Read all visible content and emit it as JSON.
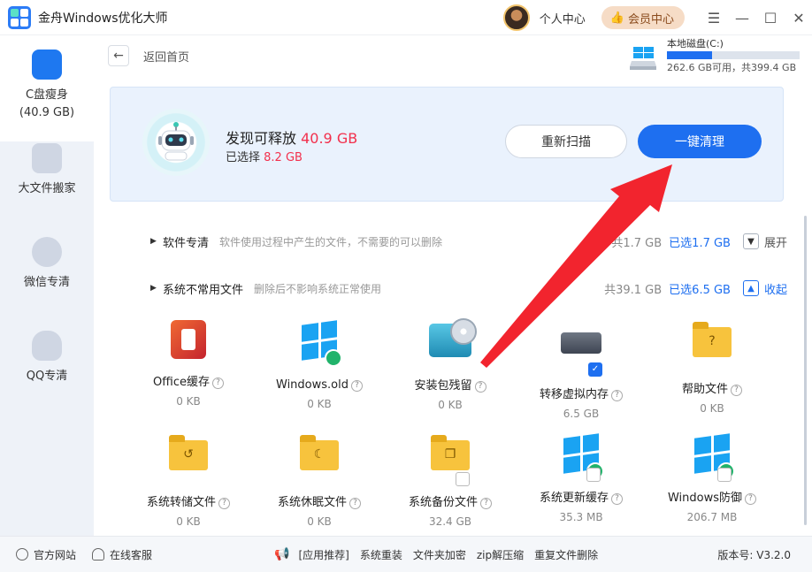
{
  "app": {
    "title": "金舟Windows优化大师",
    "user_center": "个人中心",
    "vip": "会员中心"
  },
  "sidebar": {
    "items": [
      {
        "label": "C盘瘦身",
        "sub": "(40.9 GB)"
      },
      {
        "label": "大文件搬家"
      },
      {
        "label": "微信专清"
      },
      {
        "label": "QQ专清"
      }
    ]
  },
  "nav": {
    "back": "返回首页"
  },
  "disk": {
    "name": "本地磁盘(C:)",
    "info": "262.6 GB可用，共399.4 GB",
    "used_fraction": 0.34
  },
  "scan": {
    "found_label": "发现可释放",
    "found_value": "40.9 GB",
    "selected_label": "已选择",
    "selected_value": "8.2 GB",
    "rescan": "重新扫描",
    "clean": "一键清理"
  },
  "categories": [
    {
      "name": "软件专清",
      "desc": "软件使用过程中产生的文件，不需要的可以删除",
      "total": "共1.7 GB",
      "selected": "已选1.7 GB",
      "toggle": "展开"
    },
    {
      "name": "系统不常用文件",
      "desc": "删除后不影响系统正常使用",
      "total": "共39.1 GB",
      "selected": "已选6.5 GB",
      "toggle": "收起"
    }
  ],
  "tiles": [
    {
      "name": "Office缓存",
      "size": "0 KB"
    },
    {
      "name": "Windows.old",
      "size": "0 KB"
    },
    {
      "name": "安装包残留",
      "size": "0 KB"
    },
    {
      "name": "转移虚拟内存",
      "size": "6.5 GB"
    },
    {
      "name": "帮助文件",
      "size": "0 KB"
    },
    {
      "name": "系统转储文件",
      "size": "0 KB"
    },
    {
      "name": "系统休眠文件",
      "size": "0 KB"
    },
    {
      "name": "系统备份文件",
      "size": "32.4 GB"
    },
    {
      "name": "系统更新缓存",
      "size": "35.3 MB"
    },
    {
      "name": "Windows防御",
      "size": "206.7 MB"
    }
  ],
  "footer": {
    "website": "官方网站",
    "support": "在线客服",
    "links": [
      "[应用推荐]",
      "系统重装",
      "文件夹加密",
      "zip解压缩",
      "重复文件删除"
    ],
    "version": "版本号: V3.2.0"
  },
  "colors": {
    "accent": "#1e6ff0",
    "highlight": "#f2304d",
    "arrow": "#f2242e"
  }
}
